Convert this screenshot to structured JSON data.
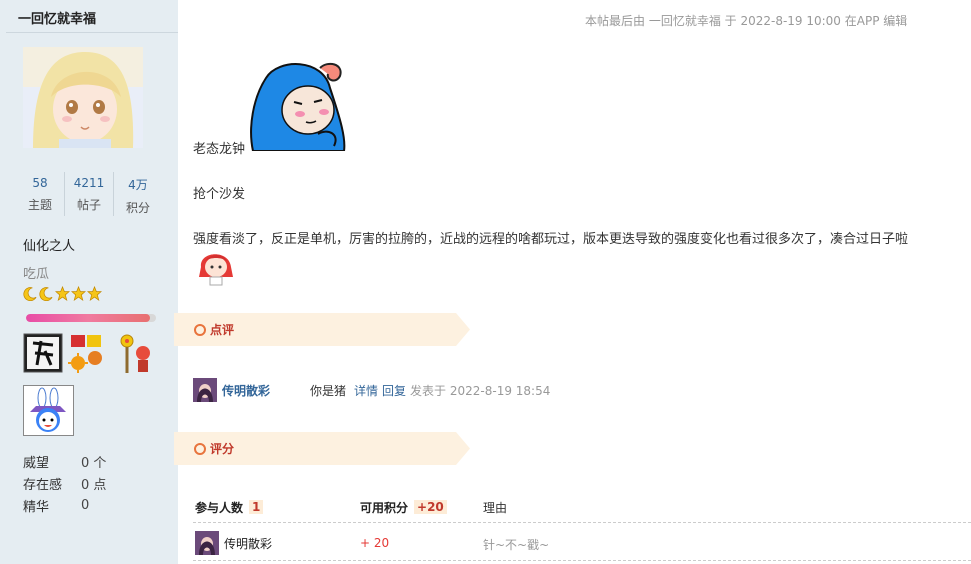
{
  "sidebar": {
    "username": "一回忆就幸福",
    "stats": [
      {
        "num": "58",
        "label": "主题"
      },
      {
        "num": "4211",
        "label": "帖子"
      },
      {
        "num": "4万",
        "label": "积分"
      }
    ],
    "title": "仙化之人",
    "subtitle": "吃瓜",
    "level_progress": 0.95,
    "info": [
      {
        "key": "威望",
        "value": "0 个"
      },
      {
        "key": "存在感",
        "value": "0 点"
      },
      {
        "key": "精华",
        "value": "0"
      }
    ]
  },
  "post": {
    "last_edit": "本帖最后由 一回忆就幸福 于 2022-8-19 10:00 在APP 编辑",
    "line1": "老态龙钟",
    "line2": "抢个沙发",
    "line3": "强度看淡了，反正是单机，厉害的拉胯的，近战的远程的啥都玩过，版本更迭导致的强度变化也看过很多次了，凑合过日子啦"
  },
  "comments_section": {
    "label": "点评",
    "items": [
      {
        "user": "传明散彩",
        "text": "你是猪",
        "detail_link": "详情",
        "reply_link": "回复",
        "time": "发表于 2022-8-19 18:54"
      }
    ]
  },
  "rating_section": {
    "label": "评分",
    "header": {
      "participants_label": "参与人数",
      "participants_count": "1",
      "points_label": "可用积分",
      "points_value": "+20",
      "reason_label": "理由"
    },
    "rows": [
      {
        "user": "传明散彩",
        "score": "+ 20",
        "reason": "针~不~戳~"
      }
    ]
  },
  "colors": {
    "sidebar_bg": "#e5edf2",
    "link": "#336699",
    "section_bg": "#fdf1e0",
    "section_title": "#c0392b",
    "score": "#e53935"
  }
}
